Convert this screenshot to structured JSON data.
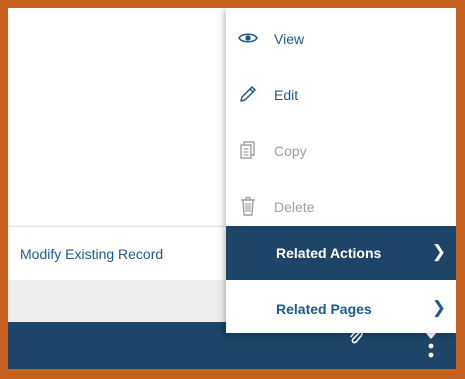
{
  "submenu": {
    "item_label": "Modify Existing Record"
  },
  "menu": {
    "items": [
      {
        "label": "View",
        "icon": "eye-icon",
        "state": "enabled"
      },
      {
        "label": "Edit",
        "icon": "pencil-icon",
        "state": "enabled"
      },
      {
        "label": "Copy",
        "icon": "copy-icon",
        "state": "disabled"
      },
      {
        "label": "Delete",
        "icon": "trash-icon",
        "state": "disabled"
      },
      {
        "label": "Related Actions",
        "icon": "chevron-right-icon",
        "state": "active"
      },
      {
        "label": "Related Pages",
        "icon": "chevron-right-icon",
        "state": "enabled"
      }
    ]
  },
  "toolbar": {
    "icons": [
      "paperclip-icon",
      "more-vertical-icon"
    ]
  },
  "colors": {
    "frame_border": "#c9611e",
    "nav_dark": "#1c4569",
    "link_blue": "#1d5a8a",
    "disabled_gray": "#9e9e9e"
  }
}
